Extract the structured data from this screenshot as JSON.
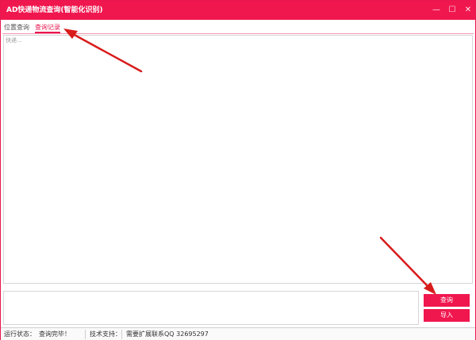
{
  "window": {
    "title": "AD快递物流查询(智能化识别)",
    "controls": {
      "minimize": "—",
      "maximize": "☐",
      "close": "✕"
    }
  },
  "tabs": [
    {
      "label": "位置查询",
      "active": false
    },
    {
      "label": "查询记录",
      "active": true
    }
  ],
  "results": {
    "first_line": "快递..."
  },
  "input": {
    "value": ""
  },
  "buttons": {
    "query": "查询",
    "import": "导入"
  },
  "status": {
    "run_label": "运行状态：",
    "run_value": "查询完毕！",
    "support_label": "技术支持：",
    "support_value": "需要扩展联系QQ 32695297"
  },
  "colors": {
    "accent": "#f0174f",
    "arrow": "#d81b1b"
  }
}
